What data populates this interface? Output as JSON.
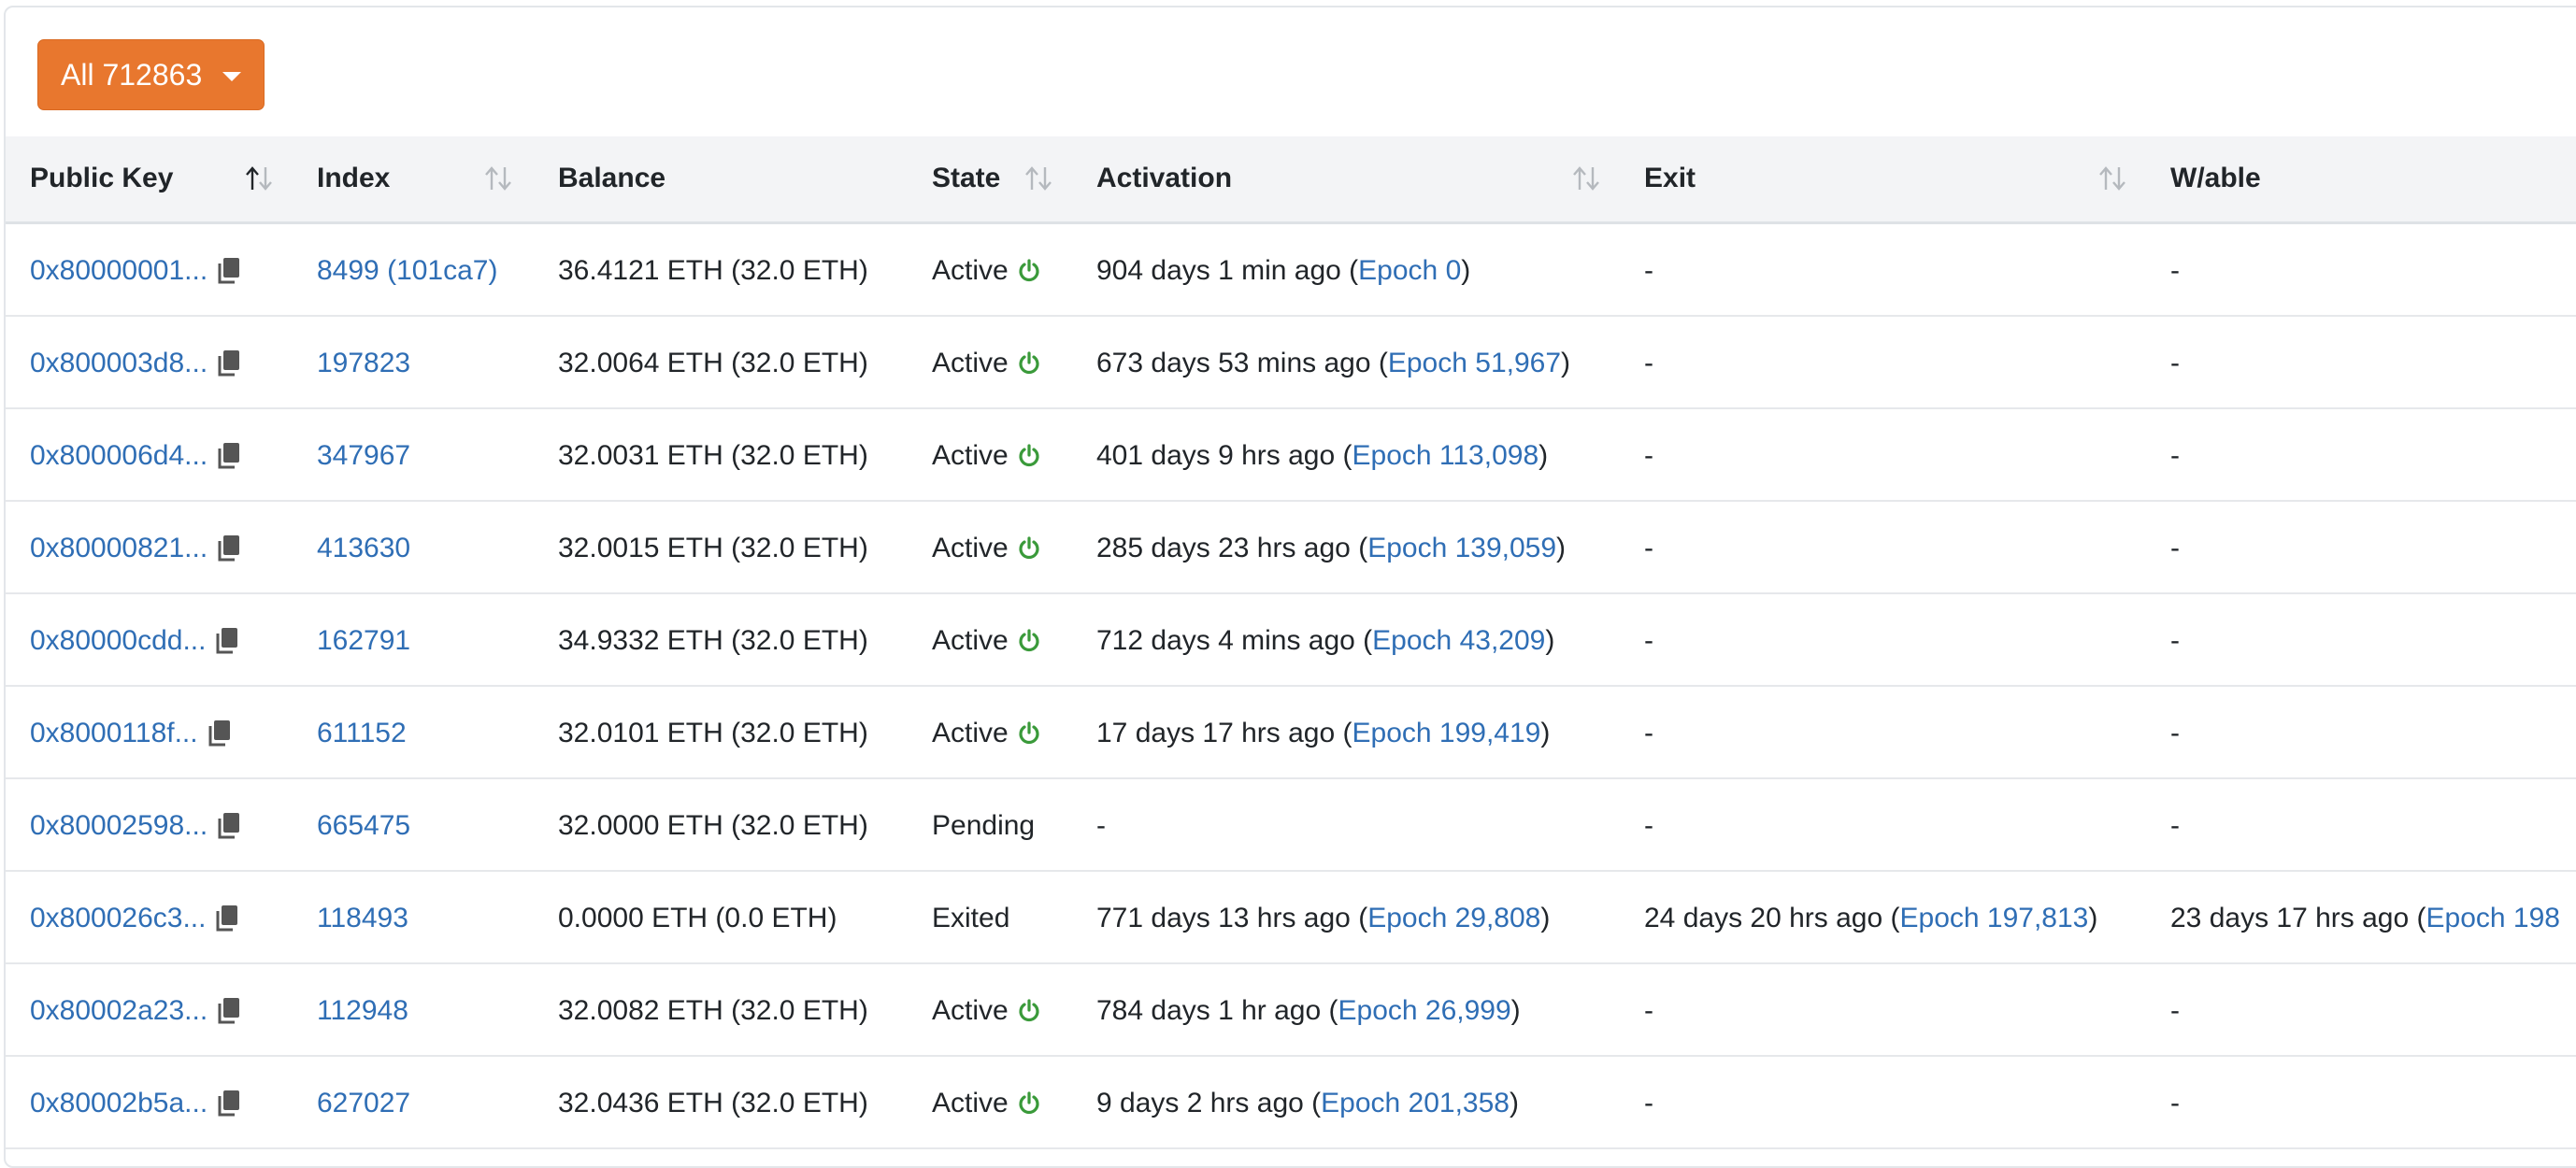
{
  "filter": {
    "label": "All 712863"
  },
  "columns": {
    "public_key": "Public Key",
    "index": "Index",
    "balance": "Balance",
    "state": "State",
    "activation": "Activation",
    "exit": "Exit",
    "withdrawable": "W/able"
  },
  "colors": {
    "accent": "#e8772e",
    "link": "#2f6eb5",
    "active": "#3a9a3a"
  },
  "rows": [
    {
      "pubkey": "0x80000001...",
      "index": "8499 (101ca7)",
      "balance": "36.4121 ETH (32.0 ETH)",
      "state": "Active",
      "active": true,
      "activation_text": "904 days 1 min ago (",
      "activation_epoch": "Epoch 0",
      "activation_close": ")",
      "exit_text": "-",
      "exit_epoch": "",
      "exit_close": "",
      "wd_text": "-",
      "wd_epoch": ""
    },
    {
      "pubkey": "0x800003d8...",
      "index": "197823",
      "balance": "32.0064 ETH (32.0 ETH)",
      "state": "Active",
      "active": true,
      "activation_text": "673 days 53 mins ago (",
      "activation_epoch": "Epoch 51,967",
      "activation_close": ")",
      "exit_text": "-",
      "exit_epoch": "",
      "exit_close": "",
      "wd_text": "-",
      "wd_epoch": ""
    },
    {
      "pubkey": "0x800006d4...",
      "index": "347967",
      "balance": "32.0031 ETH (32.0 ETH)",
      "state": "Active",
      "active": true,
      "activation_text": "401 days 9 hrs ago (",
      "activation_epoch": "Epoch 113,098",
      "activation_close": ")",
      "exit_text": "-",
      "exit_epoch": "",
      "exit_close": "",
      "wd_text": "-",
      "wd_epoch": ""
    },
    {
      "pubkey": "0x80000821...",
      "index": "413630",
      "balance": "32.0015 ETH (32.0 ETH)",
      "state": "Active",
      "active": true,
      "activation_text": "285 days 23 hrs ago (",
      "activation_epoch": "Epoch 139,059",
      "activation_close": ")",
      "exit_text": "-",
      "exit_epoch": "",
      "exit_close": "",
      "wd_text": "-",
      "wd_epoch": ""
    },
    {
      "pubkey": "0x80000cdd...",
      "index": "162791",
      "balance": "34.9332 ETH (32.0 ETH)",
      "state": "Active",
      "active": true,
      "activation_text": "712 days 4 mins ago (",
      "activation_epoch": "Epoch 43,209",
      "activation_close": ")",
      "exit_text": "-",
      "exit_epoch": "",
      "exit_close": "",
      "wd_text": "-",
      "wd_epoch": ""
    },
    {
      "pubkey": "0x8000118f...",
      "index": "611152",
      "balance": "32.0101 ETH (32.0 ETH)",
      "state": "Active",
      "active": true,
      "activation_text": "17 days 17 hrs ago (",
      "activation_epoch": "Epoch 199,419",
      "activation_close": ")",
      "exit_text": "-",
      "exit_epoch": "",
      "exit_close": "",
      "wd_text": "-",
      "wd_epoch": ""
    },
    {
      "pubkey": "0x80002598...",
      "index": "665475",
      "balance": "32.0000 ETH (32.0 ETH)",
      "state": "Pending",
      "active": false,
      "activation_text": "-",
      "activation_epoch": "",
      "activation_close": "",
      "exit_text": "-",
      "exit_epoch": "",
      "exit_close": "",
      "wd_text": "-",
      "wd_epoch": ""
    },
    {
      "pubkey": "0x800026c3...",
      "index": "118493",
      "balance": "0.0000 ETH (0.0 ETH)",
      "state": "Exited",
      "active": false,
      "activation_text": "771 days 13 hrs ago (",
      "activation_epoch": "Epoch 29,808",
      "activation_close": ")",
      "exit_text": "24 days 20 hrs ago (",
      "exit_epoch": "Epoch 197,813",
      "exit_close": ")",
      "wd_text": "23 days 17 hrs ago (",
      "wd_epoch": "Epoch 198"
    },
    {
      "pubkey": "0x80002a23...",
      "index": "112948",
      "balance": "32.0082 ETH (32.0 ETH)",
      "state": "Active",
      "active": true,
      "activation_text": "784 days 1 hr ago (",
      "activation_epoch": "Epoch 26,999",
      "activation_close": ")",
      "exit_text": "-",
      "exit_epoch": "",
      "exit_close": "",
      "wd_text": "-",
      "wd_epoch": ""
    },
    {
      "pubkey": "0x80002b5a...",
      "index": "627027",
      "balance": "32.0436 ETH (32.0 ETH)",
      "state": "Active",
      "active": true,
      "activation_text": "9 days 2 hrs ago (",
      "activation_epoch": "Epoch 201,358",
      "activation_close": ")",
      "exit_text": "-",
      "exit_epoch": "",
      "exit_close": "",
      "wd_text": "-",
      "wd_epoch": ""
    }
  ]
}
